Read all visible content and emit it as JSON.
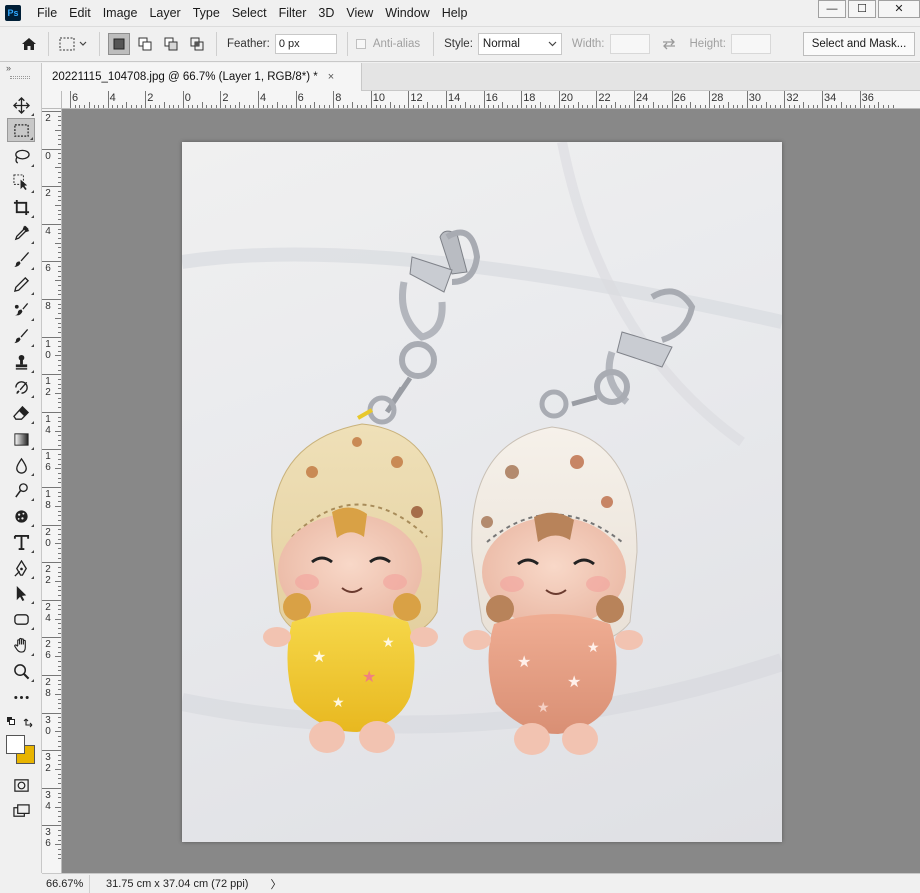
{
  "app": {
    "logo_text": "Ps",
    "menu": [
      "File",
      "Edit",
      "Image",
      "Layer",
      "Type",
      "Select",
      "Filter",
      "3D",
      "View",
      "Window",
      "Help"
    ],
    "window_controls": {
      "minimize": "—",
      "maximize": "☐",
      "close": "✕"
    }
  },
  "options": {
    "feather_label": "Feather:",
    "feather_value": "0 px",
    "antialias_label": "Anti-alias",
    "style_label": "Style:",
    "style_value": "Normal",
    "width_label": "Width:",
    "height_label": "Height:",
    "select_mask_label": "Select and Mask..."
  },
  "document": {
    "tab_title": "20221115_104708.jpg @ 66.7% (Layer 1, RGB/8*) *",
    "tab_close": "×"
  },
  "rulers": {
    "horizontal": [
      "6",
      "4",
      "2",
      "0",
      "2",
      "4",
      "6",
      "8",
      "10",
      "12",
      "14",
      "16",
      "18",
      "20",
      "22",
      "24",
      "26",
      "28",
      "30",
      "32",
      "34",
      "36"
    ],
    "vertical": [
      "2",
      "0",
      "2",
      "4",
      "6",
      "8",
      "10",
      "12",
      "14",
      "16",
      "18",
      "20",
      "22",
      "24",
      "26",
      "28",
      "30",
      "32",
      "34",
      "36"
    ]
  },
  "status": {
    "zoom": "66.67%",
    "doc_info": "31.75 cm x 37.04 cm (72 ppi)",
    "arrow": "〉"
  },
  "colors": {
    "foreground": "#ffffff",
    "background": "#e8b400",
    "canvas_bg": "#888888"
  },
  "toolbar": {
    "collapse": "»"
  }
}
